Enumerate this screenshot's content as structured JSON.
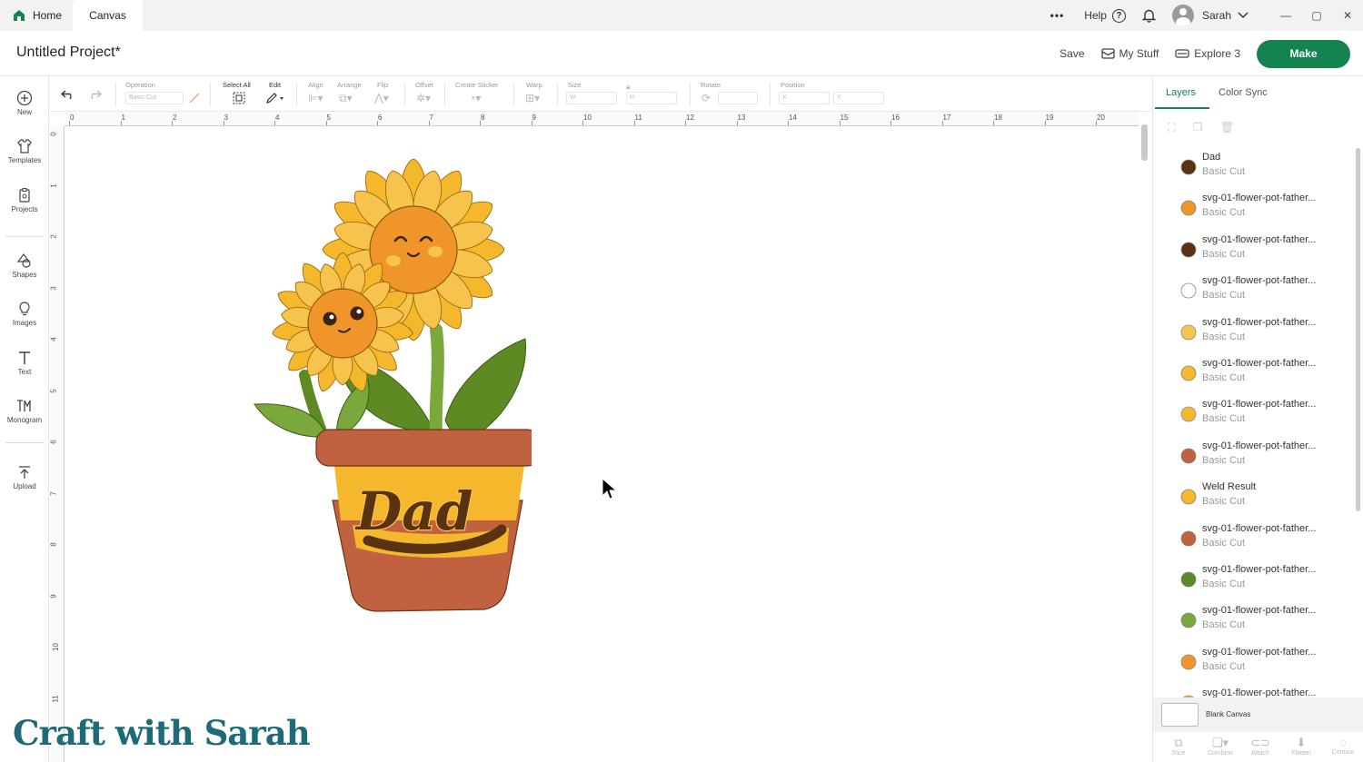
{
  "tabs": {
    "home": "Home",
    "canvas": "Canvas"
  },
  "topbar": {
    "more": "•••",
    "help": "Help",
    "help_icon": "?",
    "user": "Sarah",
    "win_min": "—",
    "win_max": "▢",
    "win_close": "✕"
  },
  "header": {
    "project_title": "Untitled Project*",
    "save": "Save",
    "my_stuff": "My Stuff",
    "machine": "Explore 3",
    "make": "Make"
  },
  "leftbar": [
    {
      "label": "New",
      "icon": "plus-circle-icon"
    },
    {
      "label": "Templates",
      "icon": "shirt-icon"
    },
    {
      "label": "Projects",
      "icon": "projects-icon"
    },
    {
      "label": "Shapes",
      "icon": "shapes-icon"
    },
    {
      "label": "Images",
      "icon": "lightbulb-icon"
    },
    {
      "label": "Text",
      "icon": "text-icon"
    },
    {
      "label": "Monogram",
      "icon": "monogram-icon"
    },
    {
      "label": "Upload",
      "icon": "upload-icon"
    }
  ],
  "toolbar": {
    "operation": "Operation",
    "operation_value": "Basic Cut",
    "select_all": "Select All",
    "edit": "Edit",
    "align": "Align",
    "arrange": "Arrange",
    "flip": "Flip",
    "offset": "Offset",
    "create_sticker": "Create Sticker",
    "warp": "Warp",
    "size": "Size",
    "size_w": "W",
    "size_h": "H",
    "rotate": "Rotate",
    "position": "Position",
    "pos_x": "X",
    "pos_y": "Y"
  },
  "ruler": {
    "top": [
      "0",
      "1",
      "2",
      "3",
      "4",
      "5",
      "6",
      "7",
      "8",
      "9",
      "10",
      "11",
      "12",
      "13",
      "14",
      "15",
      "16",
      "17",
      "18",
      "19",
      "20"
    ],
    "left": [
      "0",
      "1",
      "2",
      "3",
      "4",
      "5",
      "6",
      "7",
      "8",
      "9",
      "10",
      "11"
    ]
  },
  "design": {
    "pot_text": "Dad"
  },
  "right_panel": {
    "tab_layers": "Layers",
    "tab_color_sync": "Color Sync",
    "layers": [
      {
        "name": "Dad",
        "op": "Basic Cut",
        "color": "#5a3210"
      },
      {
        "name": "svg-01-flower-pot-father...",
        "op": "Basic Cut",
        "color": "#f0952a"
      },
      {
        "name": "svg-01-flower-pot-father...",
        "op": "Basic Cut",
        "color": "#5a3210"
      },
      {
        "name": "svg-01-flower-pot-father...",
        "op": "Basic Cut",
        "color": "#ffffff"
      },
      {
        "name": "svg-01-flower-pot-father...",
        "op": "Basic Cut",
        "color": "#f6c44d"
      },
      {
        "name": "svg-01-flower-pot-father...",
        "op": "Basic Cut",
        "color": "#f5b72b"
      },
      {
        "name": "svg-01-flower-pot-father...",
        "op": "Basic Cut",
        "color": "#f5b72b"
      },
      {
        "name": "svg-01-flower-pot-father...",
        "op": "Basic Cut",
        "color": "#c0623f"
      },
      {
        "name": "Weld Result",
        "op": "Basic Cut",
        "color": "#f5b72b"
      },
      {
        "name": "svg-01-flower-pot-father...",
        "op": "Basic Cut",
        "color": "#c0623f"
      },
      {
        "name": "svg-01-flower-pot-father...",
        "op": "Basic Cut",
        "color": "#5b8a2a"
      },
      {
        "name": "svg-01-flower-pot-father...",
        "op": "Basic Cut",
        "color": "#7aa83a"
      },
      {
        "name": "svg-01-flower-pot-father...",
        "op": "Basic Cut",
        "color": "#f0952a"
      },
      {
        "name": "svg-01-flower-pot-father...",
        "op": "",
        "color": "#f5b72b"
      }
    ],
    "blank_canvas": "Blank Canvas",
    "bottom_tools": [
      "Slice",
      "Combine",
      "Attach",
      "Flatten",
      "Contour"
    ]
  },
  "watermark": "Craft with Sarah"
}
